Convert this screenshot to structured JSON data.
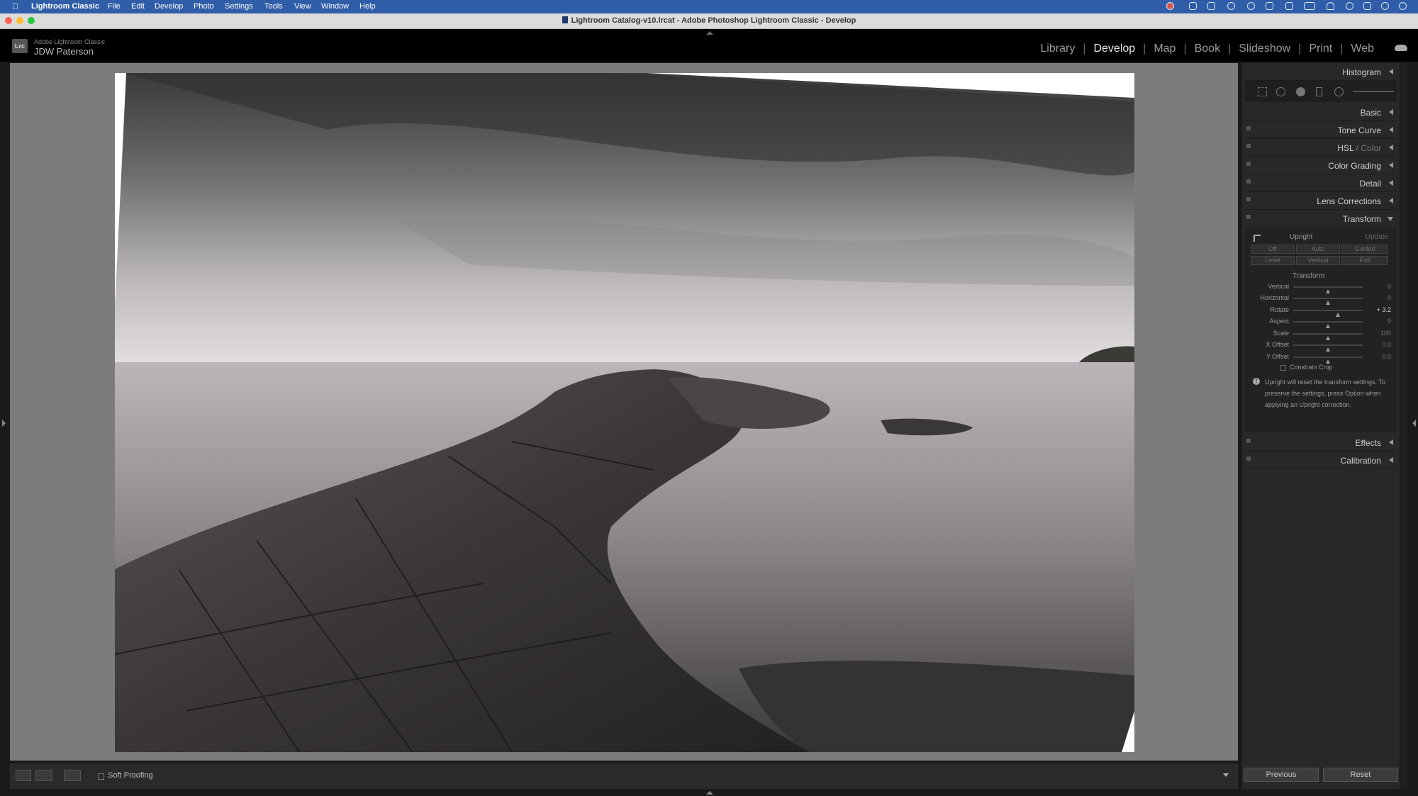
{
  "menubar": {
    "app_name": "Lightroom Classic",
    "items": [
      "File",
      "Edit",
      "Develop",
      "Photo",
      "Settings",
      "Tools",
      "View",
      "Window",
      "Help"
    ],
    "bg_color": "#2f5da8"
  },
  "window": {
    "title": "Lightroom Catalog-v10.lrcat - Adobe Photoshop Lightroom Classic - Develop"
  },
  "identity": {
    "logo_text": "Lrc",
    "product": "Adobe Lightroom Classic",
    "user": "JDW Paterson"
  },
  "modules": {
    "items": [
      "Library",
      "Develop",
      "Map",
      "Book",
      "Slideshow",
      "Print",
      "Web"
    ],
    "active": "Develop"
  },
  "toolbar": {
    "soft_proofing_label": "Soft Proofing",
    "soft_proofing_checked": false
  },
  "panels": {
    "histogram": "Histogram",
    "basic": "Basic",
    "tone_curve": "Tone Curve",
    "hsl": "HSL",
    "color": "Color",
    "color_grading": "Color Grading",
    "detail": "Detail",
    "lens_corrections": "Lens Corrections",
    "transform": "Transform",
    "effects": "Effects",
    "calibration": "Calibration"
  },
  "transform": {
    "upright_label": "Upright",
    "update_label": "Update",
    "upright_buttons": [
      "Off",
      "Auto",
      "Guided",
      "Level",
      "Vertical",
      "Full"
    ],
    "section_label": "Transform",
    "sliders": [
      {
        "label": "Vertical",
        "value": "0",
        "position": 0.5
      },
      {
        "label": "Horizontal",
        "value": "0",
        "position": 0.5
      },
      {
        "label": "Rotate",
        "value": "+ 3.2",
        "position": 0.64
      },
      {
        "label": "Aspect",
        "value": "0",
        "position": 0.5
      },
      {
        "label": "Scale",
        "value": "100",
        "position": 0.5
      },
      {
        "label": "X Offset",
        "value": "0.0",
        "position": 0.5
      },
      {
        "label": "Y Offset",
        "value": "0.0",
        "position": 0.5
      }
    ],
    "constrain_crop_label": "Constrain Crop",
    "constrain_crop_checked": false,
    "note_lines": [
      "Upright will reset the transform settings. To",
      "preserve the settings, press Option when",
      "applying an Upright correction."
    ]
  },
  "footer": {
    "previous_label": "Previous",
    "reset_label": "Reset"
  }
}
